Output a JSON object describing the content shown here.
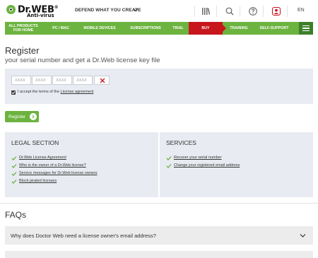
{
  "header": {
    "logo_name": "Dr.WEB",
    "logo_reg": "®",
    "logo_sub": "Anti-virus",
    "tagline": "DEFEND WHAT YOU CREATE",
    "icons": [
      "library-icon",
      "search-icon",
      "help-icon",
      "account-icon"
    ],
    "language": "EN"
  },
  "nav": {
    "items": [
      {
        "label": "ALL PRODUCTS\nFOR HOME"
      },
      {
        "label": "PC / MAC"
      },
      {
        "label": "MOBILE DEVICES"
      },
      {
        "label": "SUBSCRIPTIONS"
      },
      {
        "label": "TRIAL"
      },
      {
        "label": "BUY"
      },
      {
        "label": "TRAINING"
      },
      {
        "label": "SELF-SUPPORT"
      }
    ]
  },
  "register": {
    "title": "Register",
    "subtitle": "your serial number and get a Dr.Web license key file",
    "serial_placeholders": [
      "XXXX",
      "XXXX",
      "XXXX",
      "XXXX"
    ],
    "accept_prefix": "I accept the terms of the ",
    "accept_link": "License agreement",
    "accept_checked": true,
    "button_label": "Register"
  },
  "legal": {
    "title": "LEGAL SECTION",
    "links": [
      "Dr.Web License Agreement",
      "Who is the owner of a Dr.Web license?",
      "Service messages for Dr.Web license owners",
      "Block pirated licenses"
    ]
  },
  "services": {
    "title": "SERVICES",
    "links": [
      "Recover your serial number",
      "Change your registered email address"
    ]
  },
  "faq": {
    "title": "FAQs",
    "items": [
      {
        "question": "Why does Doctor Web need a license owner's email address?"
      }
    ]
  },
  "colors": {
    "brand_green": "#6cb33f",
    "buy_red": "#c8161d",
    "panel_bg": "#e8ebf1"
  }
}
